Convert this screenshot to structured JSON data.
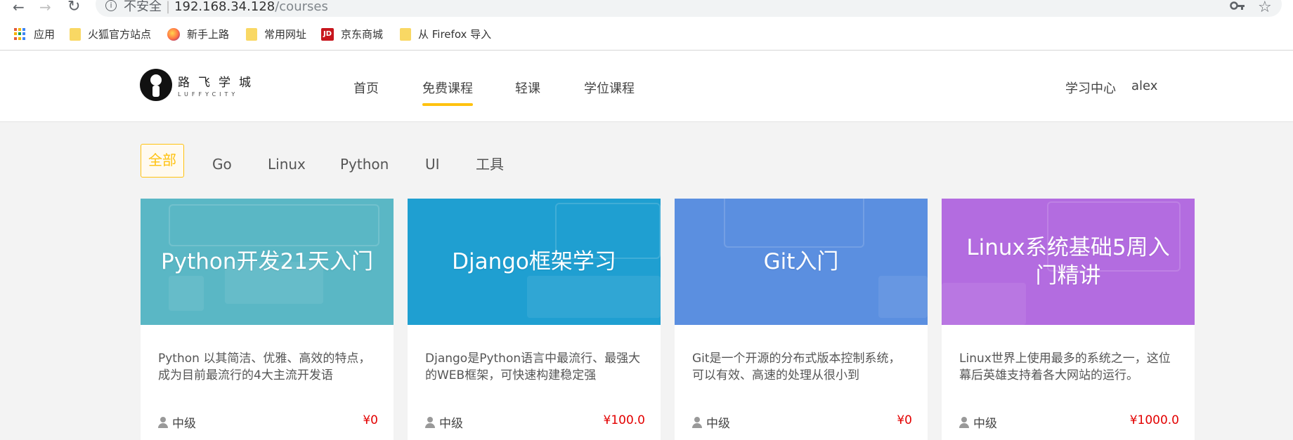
{
  "browser": {
    "security_label": "不安全",
    "url_host": "192.168.34.128",
    "url_path": "/courses",
    "bookmarks": [
      {
        "label": "应用",
        "icon": "apps-icon"
      },
      {
        "label": "火狐官方站点",
        "icon": "folder-icon"
      },
      {
        "label": "新手上路",
        "icon": "firefox-icon"
      },
      {
        "label": "常用网址",
        "icon": "folder-icon"
      },
      {
        "label": "京东商城",
        "icon": "jd-icon",
        "icon_text": "JD"
      },
      {
        "label": "从 Firefox 导入",
        "icon": "folder-icon"
      }
    ]
  },
  "header": {
    "logo_cn": "路飞学城",
    "logo_en": "LUFFYCITY",
    "nav": [
      "首页",
      "免费课程",
      "轻课",
      "学位课程"
    ],
    "active_nav": "免费课程",
    "study_center": "学习中心",
    "username": "alex"
  },
  "filters": [
    "全部",
    "Go",
    "Linux",
    "Python",
    "UI",
    "工具"
  ],
  "active_filter": "全部",
  "courses": [
    {
      "title": "Python开发21天入门",
      "description": "Python 以其简洁、优雅、高效的特点，成为目前最流行的4大主流开发语",
      "level": "中级",
      "price": "¥0",
      "banner_color": "#5ab7c5"
    },
    {
      "title": "Django框架学习",
      "description": "Django是Python语言中最流行、最强大的WEB框架，可快速构建稳定强",
      "level": "中级",
      "price": "¥100.0",
      "banner_color": "#1f9fd1"
    },
    {
      "title": "Git入门",
      "description": "Git是一个开源的分布式版本控制系统，可以有效、高速的处理从很小到",
      "level": "中级",
      "price": "¥0",
      "banner_color": "#5b8fe0"
    },
    {
      "title": "Linux系统基础5周入门精讲",
      "description": "Linux世界上使用最多的系统之一，这位幕后英雄支持着各大网站的运行。",
      "level": "中级",
      "price": "¥1000.0",
      "banner_color": "#b36ce0"
    }
  ]
}
